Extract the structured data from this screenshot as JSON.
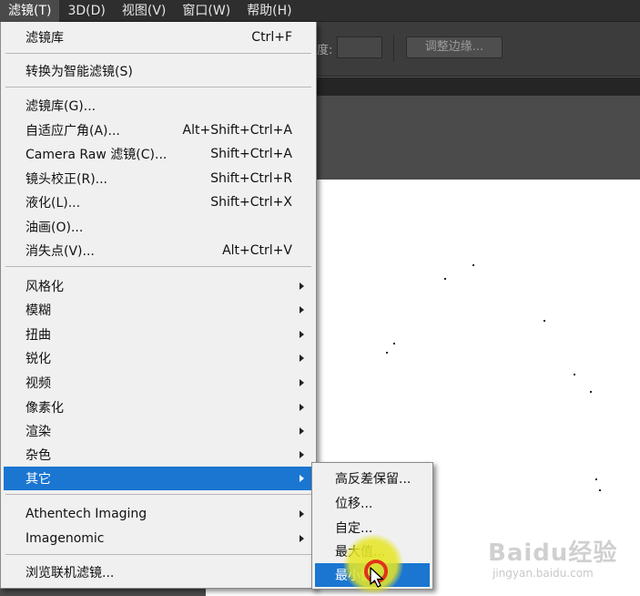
{
  "menubar": {
    "items": [
      {
        "label": "滤镜(T)"
      },
      {
        "label": "3D(D)"
      },
      {
        "label": "视图(V)"
      },
      {
        "label": "窗口(W)"
      },
      {
        "label": "帮助(H)"
      }
    ]
  },
  "options_bar": {
    "partial_label": "度:",
    "refine_edge_label": "调整边缘..."
  },
  "filter_menu": {
    "last_filter": {
      "label": "滤镜库",
      "shortcut": "Ctrl+F"
    },
    "convert_smart": {
      "label": "转换为智能滤镜(S)"
    },
    "gallery": {
      "label": "滤镜库(G)..."
    },
    "adaptive_wide": {
      "label": "自适应广角(A)...",
      "shortcut": "Alt+Shift+Ctrl+A"
    },
    "camera_raw": {
      "label": "Camera Raw 滤镜(C)...",
      "shortcut": "Shift+Ctrl+A"
    },
    "lens_correction": {
      "label": "镜头校正(R)...",
      "shortcut": "Shift+Ctrl+R"
    },
    "liquify": {
      "label": "液化(L)...",
      "shortcut": "Shift+Ctrl+X"
    },
    "oil_paint": {
      "label": "油画(O)..."
    },
    "vanishing_point": {
      "label": "消失点(V)...",
      "shortcut": "Alt+Ctrl+V"
    },
    "stylize": {
      "label": "风格化"
    },
    "blur": {
      "label": "模糊"
    },
    "distort": {
      "label": "扭曲"
    },
    "sharpen": {
      "label": "锐化"
    },
    "video": {
      "label": "视频"
    },
    "pixelate": {
      "label": "像素化"
    },
    "render": {
      "label": "渲染"
    },
    "noise": {
      "label": "杂色"
    },
    "other": {
      "label": "其它"
    },
    "athentech": {
      "label": "Athentech Imaging"
    },
    "imagenomic": {
      "label": "Imagenomic"
    },
    "browse_online": {
      "label": "浏览联机滤镜..."
    }
  },
  "other_submenu": {
    "items": [
      {
        "label": "高反差保留..."
      },
      {
        "label": "位移..."
      },
      {
        "label": "自定..."
      },
      {
        "label": "最大值..."
      },
      {
        "label": "最小值..."
      }
    ]
  },
  "watermark": {
    "logo": "Baidu经验",
    "url": "jingyan.baidu.com"
  },
  "colors": {
    "highlight": "#1a76d1",
    "menu_bg": "#f0f0f0",
    "app_bg": "#535353"
  }
}
